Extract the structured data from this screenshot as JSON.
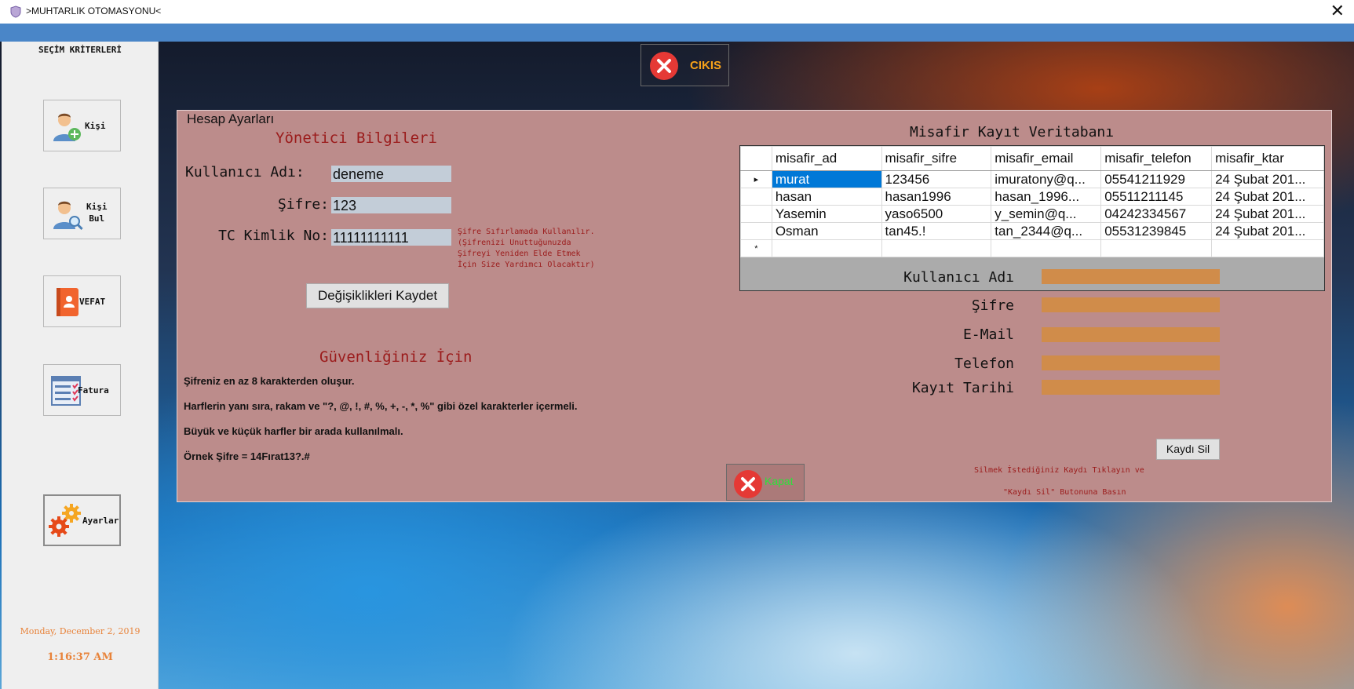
{
  "window": {
    "title": ">MUHTARLIK OTOMASYONU<",
    "close_label": "✕"
  },
  "sidebar": {
    "title": "SEÇİM KRİTERLERİ",
    "items": [
      {
        "label": "Kişi",
        "icon": "user-add-icon"
      },
      {
        "label": "Kişi\nBul",
        "icon": "user-search-icon"
      },
      {
        "label": "VEFAT",
        "icon": "contact-book-icon"
      },
      {
        "label": "Fatura",
        "icon": "checklist-icon"
      },
      {
        "label": "Ayarlar",
        "icon": "gears-icon"
      }
    ],
    "date": "Monday, December 2, 2019",
    "time": "1:16:37 AM"
  },
  "exit_button": {
    "label": "CIKIS"
  },
  "settings": {
    "group_title": "Hesap Ayarları",
    "admin_heading": "Yönetici Bilgileri",
    "username_label": "Kullanıcı Adı:",
    "username_value": "deneme",
    "password_label": "Şifre:",
    "password_value": "123",
    "tc_label": "TC Kimlik No:",
    "tc_value": "11111111111",
    "tc_note": [
      "Şifre Sıfırlamada Kullanılır.",
      "(Şifrenizi Unuttuğunuzda",
      "Şifreyi Yeniden Elde Etmek",
      "İçin Size Yardımcı Olacaktır)"
    ],
    "save_label": "Değişiklikleri Kaydet",
    "security_heading": "Güvenliğiniz İçin",
    "rules": [
      "Şifreniz en az 8 karakterden oluşur.",
      "Harflerin yanı sıra, rakam ve \"?, @, !, #, %, +, -, *, %\" gibi özel karakterler içermeli.",
      "Büyük ve küçük harfler bir arada kullanılmalı.",
      "Örnek Şifre = 14Fırat13?.#"
    ],
    "close_label": "Kapat"
  },
  "guest_db": {
    "title": "Misafir Kayıt Veritabanı",
    "columns": [
      "misafir_ad",
      "misafir_sifre",
      "misafir_email",
      "misafir_telefon",
      "misafir_ktar"
    ],
    "rows": [
      [
        "murat",
        "123456",
        "imuratony@q...",
        "05541211929",
        "24 Şubat 201..."
      ],
      [
        "hasan",
        "hasan1996",
        "hasan_1996...",
        "05511211145",
        "24 Şubat 201..."
      ],
      [
        "Yasemin",
        "yaso6500",
        "y_semin@q...",
        "04242334567",
        "24 Şubat 201..."
      ],
      [
        "Osman",
        "tan45.!",
        "tan_2344@q...",
        "05531239845",
        "24 Şubat 201..."
      ]
    ],
    "current_row_marker": "▸",
    "new_row_marker": "*",
    "form": {
      "username_label": "Kullanıcı Adı",
      "password_label": "Şifre",
      "email_label": "E-Mail",
      "phone_label": "Telefon",
      "date_label": "Kayıt Tarihi",
      "delete_label": "Kaydı Sil",
      "hint_line1": "Silmek İstediğiniz Kaydı Tıklayın ve",
      "hint_line2": "\"Kaydı Sil\" Butonuna Basın"
    }
  },
  "colors": {
    "panel": "#bc8c8b",
    "accent_red": "#9b1b1b",
    "orange_input": "#d08c4a",
    "exit_text": "#f6a21a",
    "kapat_text": "#2ee03a",
    "clock": "#e8833a"
  }
}
